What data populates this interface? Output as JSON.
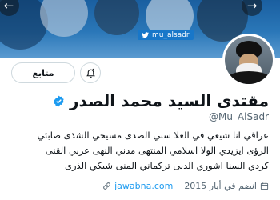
{
  "banner": {
    "handle_tag": "mu_alsadr"
  },
  "actions": {
    "follow_label": "متابع"
  },
  "profile": {
    "display_name": "مقتدى السيد محمد الصدر",
    "handle": "@Mu_AlSadr",
    "bio_lines": [
      "عراقي انا شيعي في العلا سني الصدى مسيحي الشذى صابئي",
      "الرؤى ايزيدي الولا اسلامي المنتهى مدني النهى عربي القنى",
      "كردي السنا اشوري الدنى تركماني المنى شبكي الذرى"
    ],
    "joined": "انضم في أيار 2015",
    "website": "jawabna.com"
  },
  "colors": {
    "accent": "#1d9bf0",
    "text_primary": "#0f1419",
    "text_secondary": "#536471",
    "border": "#cfd9de"
  },
  "icons": [
    "back-arrow-icon",
    "forward-arrow-icon",
    "twitter-bird-icon",
    "notification-bell-icon",
    "verified-badge-icon",
    "calendar-icon",
    "link-icon"
  ]
}
